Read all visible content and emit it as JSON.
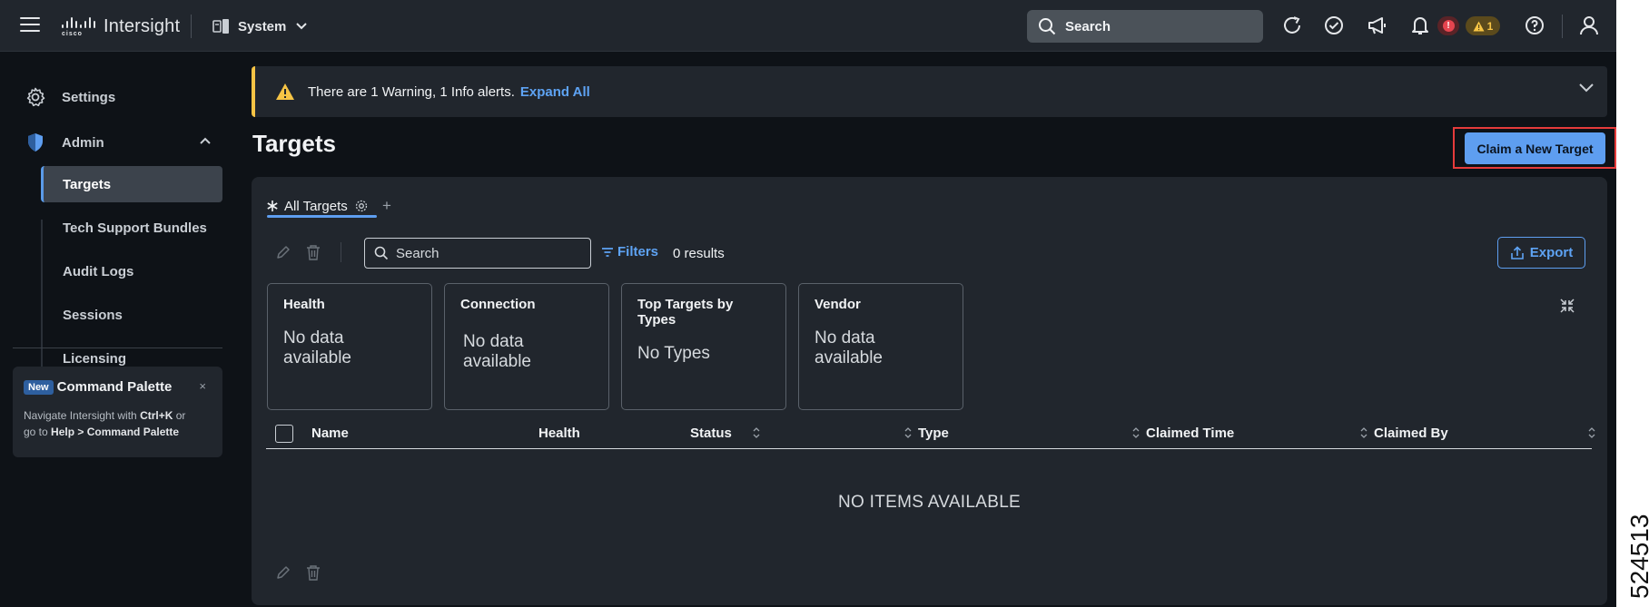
{
  "topbar": {
    "product_name": "Intersight",
    "logo_text": "cisco",
    "scope_label": "System",
    "search_placeholder": "Search",
    "alert_count_error": "!",
    "alert_count_warning": "1"
  },
  "sidebar": {
    "settings_label": "Settings",
    "admin_label": "Admin",
    "items": [
      {
        "label": "Targets",
        "active": true
      },
      {
        "label": "Tech Support Bundles"
      },
      {
        "label": "Audit Logs"
      },
      {
        "label": "Sessions"
      },
      {
        "label": "Licensing"
      }
    ],
    "command_palette": {
      "badge": "New",
      "title": "Command Palette",
      "close": "×",
      "desc_1": "Navigate Intersight with ",
      "desc_key": "Ctrl+K",
      "desc_2": " or",
      "desc_3": "go to ",
      "desc_path": "Help > Command Palette"
    }
  },
  "alert": {
    "text": "There are 1 Warning, 1 Info alerts.",
    "link": "Expand All"
  },
  "page": {
    "title": "Targets",
    "claim_button": "Claim a New Target"
  },
  "table_view": {
    "tab_label": "All Targets",
    "search_placeholder": "Search",
    "filters_label": "Filters",
    "results": "0 results",
    "export_label": "Export",
    "cards": [
      {
        "title": "Health",
        "value": "No data available"
      },
      {
        "title": "Connection",
        "value": "No data available"
      },
      {
        "title": "Top Targets by Types",
        "value": "No Types"
      },
      {
        "title": "Vendor",
        "value": "No data available"
      }
    ],
    "columns": [
      "Name",
      "Health",
      "Status",
      "Type",
      "Claimed Time",
      "Claimed By"
    ],
    "empty_text": "NO ITEMS AVAILABLE"
  },
  "figure_id": "524513",
  "colors": {
    "accent": "#5e9ef0",
    "warning": "#f6c445",
    "error": "#e5454f",
    "highlight_box": "#e53b3b"
  }
}
